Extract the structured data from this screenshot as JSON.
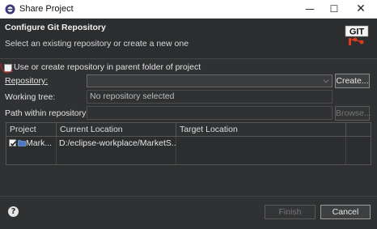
{
  "window": {
    "title": "Share Project",
    "minimize_glyph": "—",
    "maximize_glyph": "☐",
    "close_glyph": "✕"
  },
  "header": {
    "title": "Configure Git Repository",
    "description": "Select an existing repository or create a new one",
    "logo_text": "GIT"
  },
  "form": {
    "parent_repo_checkbox_label": "Use or create repository in parent folder of project",
    "parent_repo_checked": false,
    "repository_label": "Repository:",
    "repository_value": "",
    "create_button": "Create...",
    "working_tree_label": "Working tree:",
    "working_tree_value": "No repository selected",
    "path_label": "Path within repository:",
    "path_value": "",
    "browse_button": "Browse..."
  },
  "table": {
    "columns": [
      "Project",
      "Current Location",
      "Target Location"
    ],
    "rows": [
      {
        "checked": true,
        "project": "Mark...",
        "current_location": "D:/eclipse-workplace/MarketS...",
        "target_location": ""
      }
    ]
  },
  "footer": {
    "help_glyph": "?",
    "finish_button": "Finish",
    "cancel_button": "Cancel"
  },
  "colors": {
    "dialog_bg": "#2f3133",
    "titlebar_bg": "#ffffff",
    "annotation_red": "#d02020"
  }
}
